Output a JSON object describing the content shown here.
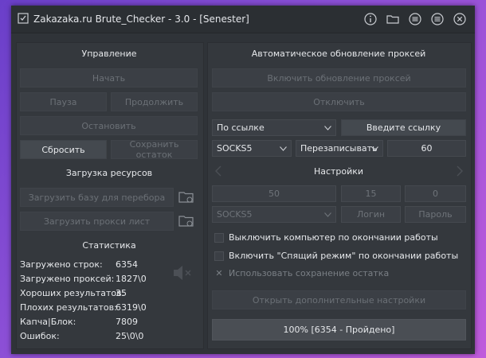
{
  "window": {
    "title": "Zakazaka.ru Brute_Checker - 3.0 - [Senester]"
  },
  "titlebar_icons": [
    "info-icon",
    "folder-icon",
    "list-icon",
    "menu-icon",
    "close-icon"
  ],
  "control": {
    "title": "Управление",
    "start": "Начать",
    "pause": "Пауза",
    "resume": "Продолжить",
    "stop": "Остановить",
    "reset": "Сбросить",
    "save_remainder": "Сохранить остаток"
  },
  "resources": {
    "title": "Загрузка ресурсов",
    "load_base": "Загрузить базу для перебора",
    "load_proxy": "Загрузить прокси лист"
  },
  "stats": {
    "title": "Статистика",
    "rows": [
      {
        "label": "Загружено строк:",
        "value": "6354"
      },
      {
        "label": "Загружено проксей:",
        "value": "1827\\0"
      },
      {
        "label": "Хороших результатов:",
        "value": "35"
      },
      {
        "label": "Плохих результатов:",
        "value": "6319\\0"
      },
      {
        "label": "Капча|Блок:",
        "value": "7809"
      },
      {
        "label": "Ошибок:",
        "value": "25\\0\\0"
      }
    ]
  },
  "proxy_update": {
    "title": "Автоматическое обновление проксей",
    "enable": "Включить обновление проксей",
    "disable": "Отключить",
    "source_select": "По ссылке",
    "enter_link": "Введите ссылку",
    "proxy_type": "SOCKS5",
    "mode": "Перезаписывать",
    "interval": "60"
  },
  "settings": {
    "title": "Настройки",
    "threads": "50",
    "timeout": "15",
    "retries": "0",
    "proxy_type": "SOCKS5",
    "login": "Логин",
    "password": "Пароль",
    "shutdown_label": "Выключить компьютер по окончании работы",
    "sleep_label": "Включить \"Спящий режим\" по окончании работы",
    "save_remainder_label": "Использовать сохранение остатка",
    "advanced": "Открыть дополнительные настройки"
  },
  "progress": {
    "label": "100% [6354 - Пройдено]",
    "fraction": 1.0
  },
  "colors": {
    "window_bg": "#2f3338",
    "panel_bg": "#34383d",
    "button_bg": "#3b3f45",
    "text": "#e6e8eb",
    "disabled_text": "#7d8288"
  }
}
